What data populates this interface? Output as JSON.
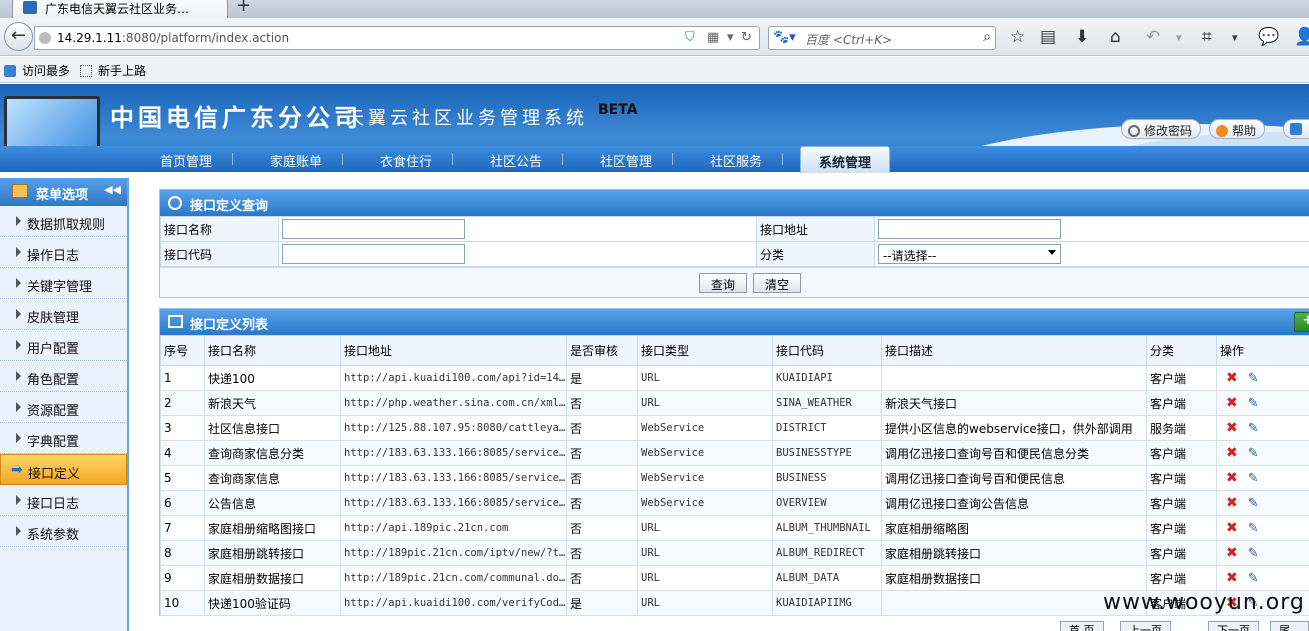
{
  "browser": {
    "tab_title": "广东电信天翼云社区业务…",
    "url_host": "14.29.1.11",
    "url_rest": ":8080/platform/index.action",
    "search_placeholder": "百度 <Ctrl+K>",
    "bookmarks": [
      "访问最多",
      "新手上路"
    ]
  },
  "header": {
    "company": "中国电信广东分公司",
    "system_name": "天翼云社区业务管理系统",
    "beta": "BETA",
    "change_password": "修改密码",
    "help": "帮助"
  },
  "main_nav": [
    "首页管理",
    "家庭账单",
    "衣食住行",
    "社区公告",
    "社区管理",
    "社区服务"
  ],
  "main_nav_active": "系统管理",
  "sidebar": {
    "title": "菜单选项",
    "items": [
      {
        "label": "数据抓取规则"
      },
      {
        "label": "操作日志"
      },
      {
        "label": "关键字管理"
      },
      {
        "label": "皮肤管理"
      },
      {
        "label": "用户配置"
      },
      {
        "label": "角色配置"
      },
      {
        "label": "资源配置"
      },
      {
        "label": "字典配置"
      },
      {
        "label": "接口定义",
        "selected": true
      },
      {
        "label": "接口日志"
      },
      {
        "label": "系统参数"
      }
    ]
  },
  "query_panel": {
    "title": "接口定义查询",
    "name_label": "接口名称",
    "address_label": "接口地址",
    "code_label": "接口代码",
    "category_label": "分类",
    "category_value": "--请选择--",
    "search_button": "查询",
    "clear_button": "清空"
  },
  "list_panel": {
    "title": "接口定义列表",
    "add_icon": "plus-icon",
    "columns": [
      "序号",
      "接口名称",
      "接口地址",
      "是否审核",
      "接口类型",
      "接口代码",
      "接口描述",
      "分类",
      "操作"
    ],
    "rows": [
      [
        "1",
        "快递100",
        "http://api.kuaidi100.com/api?id=14…",
        "是",
        "URL",
        "KUAIDIAPI",
        "",
        "客户端"
      ],
      [
        "2",
        "新浪天气",
        "http://php.weather.sina.com.cn/xml…",
        "否",
        "URL",
        "SINA_WEATHER",
        "新浪天气接口",
        "客户端"
      ],
      [
        "3",
        "社区信息接口",
        "http://125.88.107.95:8080/cattleya…",
        "否",
        "WebService",
        "DISTRICT",
        "提供小区信息的webservice接口，供外部调用",
        "服务端"
      ],
      [
        "4",
        "查询商家信息分类",
        "http://183.63.133.166:8085/service…",
        "否",
        "WebService",
        "BUSINESSTYPE",
        "调用亿迅接口查询号百和便民信息分类",
        "客户端"
      ],
      [
        "5",
        "查询商家信息",
        "http://183.63.133.166:8085/service…",
        "否",
        "WebService",
        "BUSINESS",
        "调用亿迅接口查询号百和便民信息",
        "客户端"
      ],
      [
        "6",
        "公告信息",
        "http://183.63.133.166:8085/service…",
        "否",
        "WebService",
        "OVERVIEW",
        "调用亿迅接口查询公告信息",
        "客户端"
      ],
      [
        "7",
        "家庭相册缩略图接口",
        "http://api.189pic.21cn.com",
        "否",
        "URL",
        "ALBUM_THUMBNAIL",
        "家庭相册缩略图",
        "客户端"
      ],
      [
        "8",
        "家庭相册跳转接口",
        "http://189pic.21cn.com/iptv/new/?t…",
        "否",
        "URL",
        "ALBUM_REDIRECT",
        "家庭相册跳转接口",
        "客户端"
      ],
      [
        "9",
        "家庭相册数据接口",
        "http://189pic.21cn.com/communal.do…",
        "否",
        "URL",
        "ALBUM_DATA",
        "家庭相册数据接口",
        "客户端"
      ],
      [
        "10",
        "快递100验证码",
        "http://api.kuaidi100.com/verifyCod…",
        "是",
        "URL",
        "KUAIDIAPIIMG",
        "",
        "客户端"
      ]
    ]
  },
  "watermark": "www.wooyun.org"
}
